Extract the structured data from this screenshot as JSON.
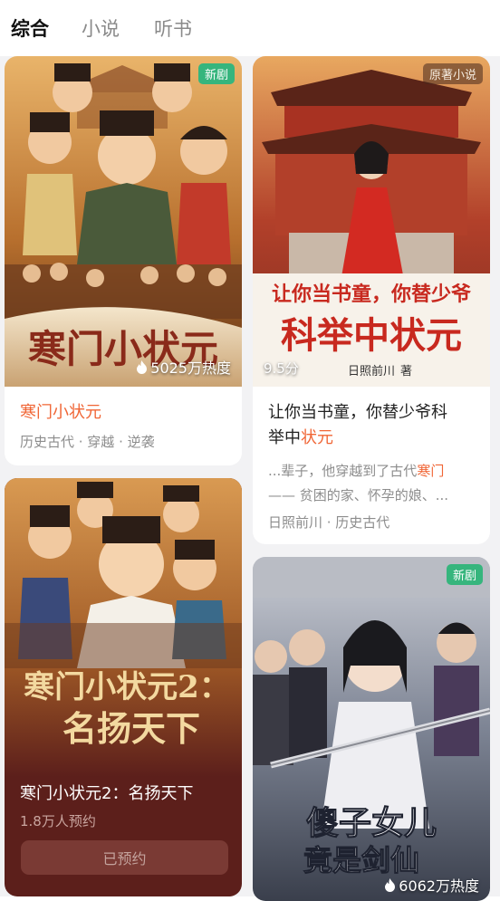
{
  "tabs": [
    {
      "label": "综合",
      "active": true
    },
    {
      "label": "小说",
      "active": false
    },
    {
      "label": "听书",
      "active": false
    }
  ],
  "cards": [
    {
      "badge": "新剧",
      "cover_title": "寒门小状元",
      "heat": "5025万热度",
      "title": "寒门小状元",
      "tags": "历史古代 · 穿越 · 逆袭"
    },
    {
      "badge": "原著小说",
      "cover_title": "让你当书童，你替少爷",
      "cover_title_2": "科举中状元",
      "cover_author": "日照前川",
      "cover_author_suffix": "著",
      "score": "9.5分",
      "title_line1": "让你当书童，你替少爷科",
      "title_line2_plain": "举中",
      "title_line2_hl": "状元",
      "snippet_line1_plain": "...辈子，他穿越到了古代",
      "snippet_line1_hl": "寒门",
      "snippet_line2": "—— 贫困的家、怀孕的娘、...",
      "tags": "日照前川 · 历史古代"
    },
    {
      "cover_title": "寒门小状元2：",
      "cover_subtitle": "名扬天下",
      "title": "寒门小状元2：名扬天下",
      "reservations": "1.8万人预约",
      "button": "已预约"
    },
    {
      "badge": "新剧",
      "cover_title": "傻子女儿",
      "cover_subtitle": "竟是剑仙",
      "heat": "6062万热度"
    }
  ],
  "colors": {
    "accent": "#f06535",
    "badge_green": "#36b57d",
    "dark_card": "#5c1f1b"
  }
}
